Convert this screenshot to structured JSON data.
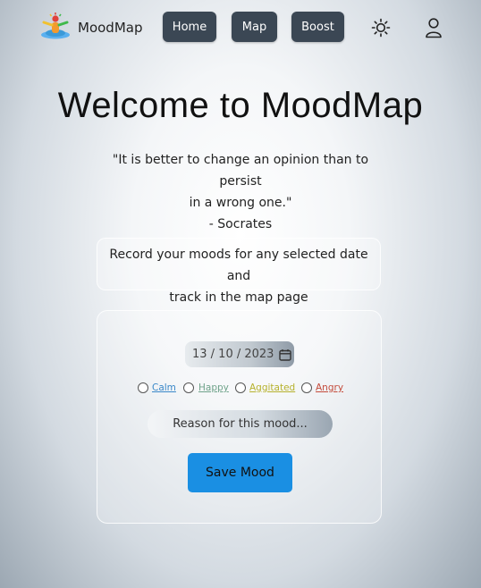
{
  "nav": {
    "brand": "MoodMap",
    "links": [
      {
        "label": "Home"
      },
      {
        "label": "Map"
      },
      {
        "label": "Boost"
      }
    ],
    "icons": {
      "theme": "sun-icon",
      "profile": "user-icon"
    }
  },
  "main": {
    "title": "Welcome to MoodMap",
    "quote": {
      "line1": "\"It is better to change an opinion than to persist",
      "line2": "in a wrong one.\"",
      "author": "- Socrates"
    },
    "info": {
      "line1": "Record your moods for any selected date and",
      "line2": "track in the map page"
    }
  },
  "form": {
    "date_value": "13 / 10 / 2023",
    "moods": [
      {
        "label": "Calm",
        "color": "#3a88c9"
      },
      {
        "label": "Happy",
        "color": "#6fa38a"
      },
      {
        "label": "Aggitated",
        "color": "#b6b12c"
      },
      {
        "label": "Angry",
        "color": "#c44b3b"
      }
    ],
    "reason_placeholder": "Reason for this mood...",
    "save_label": "Save Mood"
  }
}
